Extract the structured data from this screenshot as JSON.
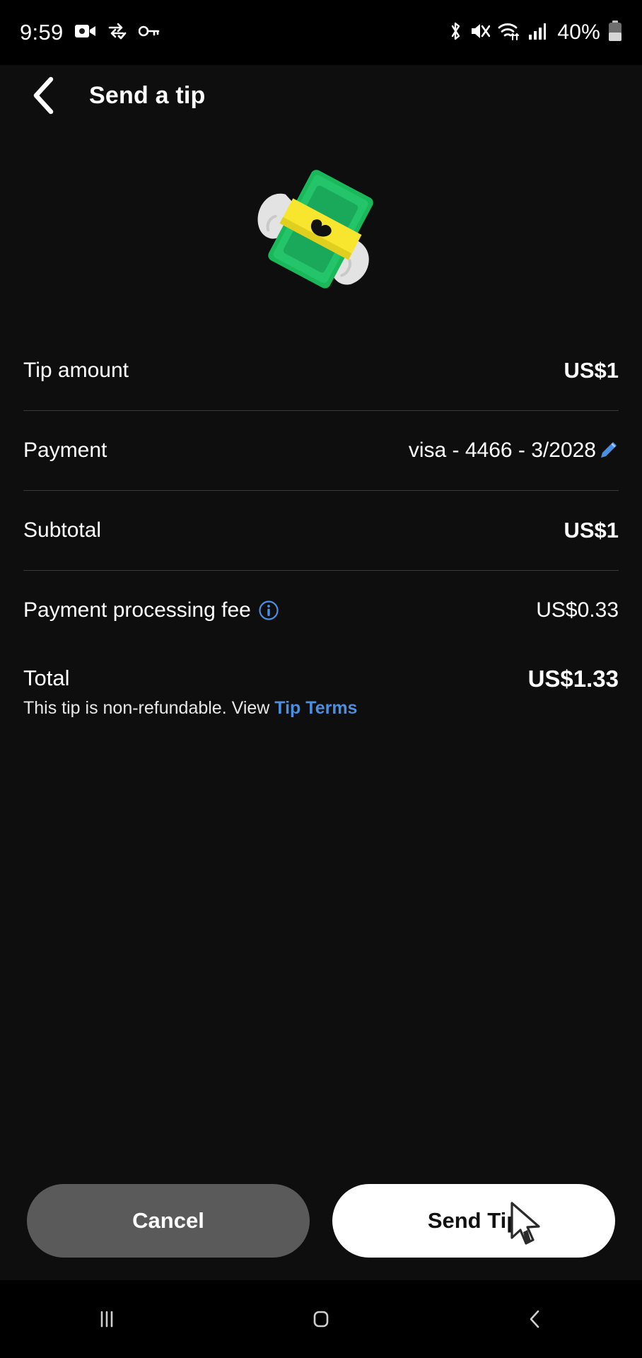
{
  "status_bar": {
    "time": "9:59",
    "battery_percent": "40%",
    "left_icons": [
      "video-camera-icon",
      "data-sync-check-icon",
      "vpn-key-icon"
    ],
    "right_icons": [
      "bluetooth-icon",
      "sound-muted-icon",
      "wifi-icon",
      "cellular-signal-icon",
      "battery-icon"
    ]
  },
  "header": {
    "title": "Send a tip",
    "back_icon": "back-chevron-icon"
  },
  "hero": {
    "illustration": "money-with-wings-emoji"
  },
  "rows": [
    {
      "label": "Tip amount",
      "value": "US$1",
      "bold": true
    },
    {
      "label": "Payment",
      "value": "visa - 4466 - 3/2028",
      "bold": false,
      "trailing_icon": "edit-pencil-icon"
    },
    {
      "label": "Subtotal",
      "value": "US$1",
      "bold": true
    },
    {
      "label": "Payment processing fee",
      "value": "US$0.33",
      "bold": false,
      "leading_icon": "info-circle-icon"
    }
  ],
  "total": {
    "label": "Total",
    "value": "US$1.33",
    "note_prefix": "This tip is non-refundable. View ",
    "note_link": "Tip Terms"
  },
  "footer": {
    "cancel_label": "Cancel",
    "send_label": "Send Tip"
  },
  "nav_bar": {
    "recents": "recents-icon",
    "home": "home-icon",
    "back": "back-icon"
  },
  "colors": {
    "background": "#0e0e0e",
    "accent_blue": "#4a8fe0",
    "divider": "#3a3a3a",
    "cancel_button": "#5a5a5a",
    "send_button": "#ffffff"
  }
}
